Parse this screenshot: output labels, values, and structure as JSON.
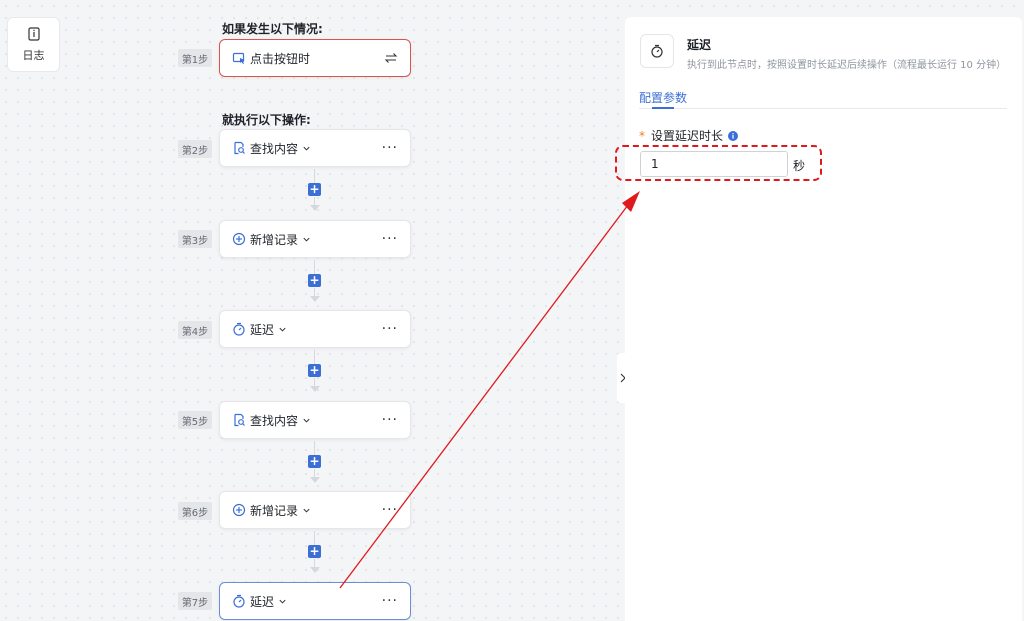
{
  "sidebar": {
    "log_label": "日志"
  },
  "flow": {
    "condition_title": "如果发生以下情况:",
    "action_title": "就执行以下操作:",
    "add_label": "+",
    "more_label": "···",
    "steps": [
      {
        "tag": "第1步",
        "label": "点击按钮时",
        "icon": "cursor-click-icon"
      },
      {
        "tag": "第2步",
        "label": "查找内容",
        "icon": "search-doc-icon"
      },
      {
        "tag": "第3步",
        "label": "新增记录",
        "icon": "plus-circle-icon"
      },
      {
        "tag": "第4步",
        "label": "延迟",
        "icon": "timer-icon"
      },
      {
        "tag": "第5步",
        "label": "查找内容",
        "icon": "search-doc-icon"
      },
      {
        "tag": "第6步",
        "label": "新增记录",
        "icon": "plus-circle-icon"
      },
      {
        "tag": "第7步",
        "label": "延迟",
        "icon": "timer-icon"
      }
    ]
  },
  "panel": {
    "title": "延迟",
    "description": "执行到此节点时，按照设置时长延迟后续操作（流程最长运行 10 分钟）",
    "tab": "配置参数",
    "field_label": "设置延迟时长",
    "required_mark": "*",
    "delay_value": "1",
    "unit": "秒"
  },
  "colors": {
    "accent": "#3c6fd6",
    "annotation": "#e0191c",
    "trigger_border": "#d9534f"
  }
}
